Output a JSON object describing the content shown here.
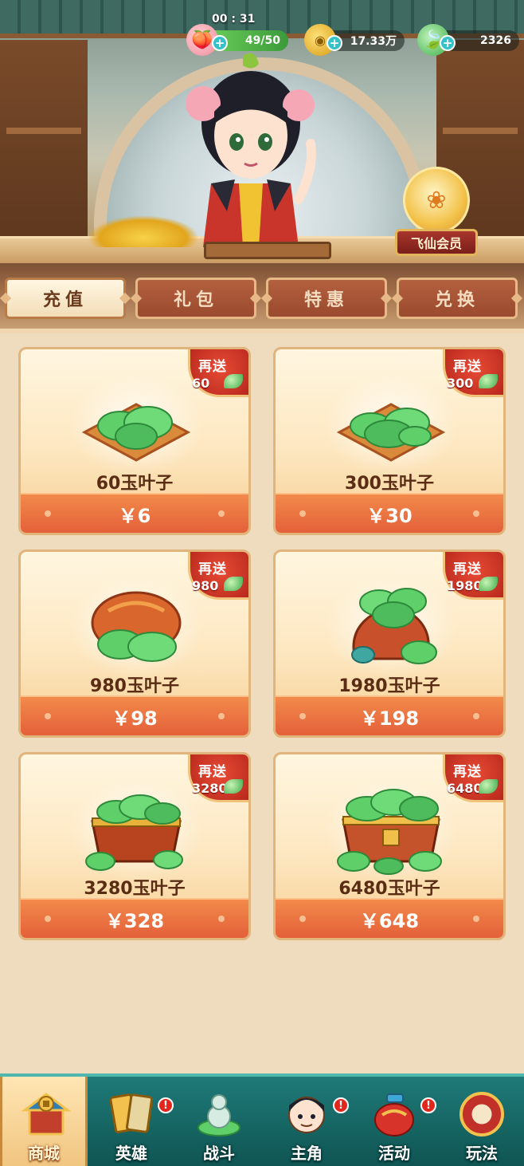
{
  "status": {
    "timer": "00 : 31",
    "stamina": "49/50",
    "coins": "17.33万",
    "leaves": "2326"
  },
  "vip": {
    "label": "飞仙会员"
  },
  "tabs": [
    {
      "label": "充值",
      "active": true
    },
    {
      "label": "礼包",
      "active": false
    },
    {
      "label": "特惠",
      "active": false
    },
    {
      "label": "兑换",
      "active": false
    }
  ],
  "products": [
    {
      "bonus_title": "再送",
      "bonus": "60",
      "name": "60玉叶子",
      "price": "￥6",
      "art": "leaf-plate"
    },
    {
      "bonus_title": "再送",
      "bonus": "300",
      "name": "300玉叶子",
      "price": "￥30",
      "art": "leaf-plate"
    },
    {
      "bonus_title": "再送",
      "bonus": "980",
      "name": "980玉叶子",
      "price": "￥98",
      "art": "leaf-bag"
    },
    {
      "bonus_title": "再送",
      "bonus": "1980",
      "name": "1980玉叶子",
      "price": "￥198",
      "art": "leaf-sack"
    },
    {
      "bonus_title": "再送",
      "bonus": "3280",
      "name": "3280玉叶子",
      "price": "￥328",
      "art": "leaf-chest"
    },
    {
      "bonus_title": "再送",
      "bonus": "6480",
      "name": "6480玉叶子",
      "price": "￥648",
      "art": "leaf-chest-large"
    }
  ],
  "nav": [
    {
      "label": "商城",
      "icon": "shop-icon",
      "active": true,
      "badge": false
    },
    {
      "label": "英雄",
      "icon": "hero-cards-icon",
      "active": false,
      "badge": true
    },
    {
      "label": "战斗",
      "icon": "battle-gourd-icon",
      "active": false,
      "badge": false
    },
    {
      "label": "主角",
      "icon": "protagonist-icon",
      "active": false,
      "badge": true
    },
    {
      "label": "活动",
      "icon": "event-jar-icon",
      "active": false,
      "badge": true
    },
    {
      "label": "玩法",
      "icon": "drum-icon",
      "active": false,
      "badge": false
    }
  ],
  "badge_mark": "!",
  "colors": {
    "accent": "#e4603a",
    "badge": "#c4301f",
    "nav_bg": "#1f7a78",
    "text_brown": "#5a2c14"
  }
}
